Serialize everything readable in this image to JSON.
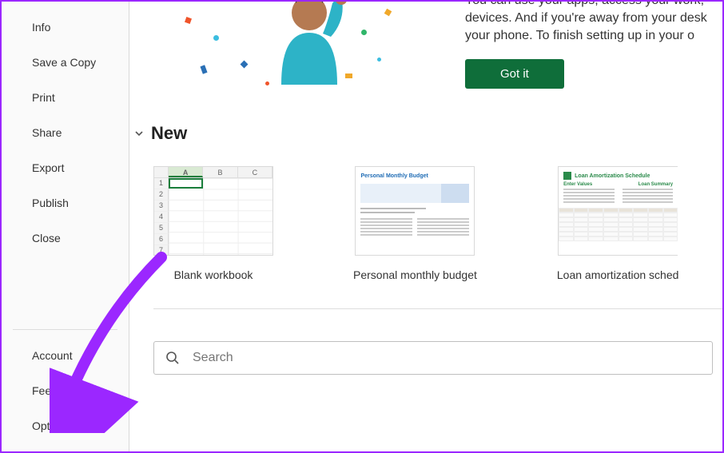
{
  "sidebar": {
    "top_items": [
      {
        "label": "Info"
      },
      {
        "label": "Save a Copy"
      },
      {
        "label": "Print"
      },
      {
        "label": "Share"
      },
      {
        "label": "Export"
      },
      {
        "label": "Publish"
      },
      {
        "label": "Close"
      }
    ],
    "bottom_items": [
      {
        "label": "Account"
      },
      {
        "label": "Feedback"
      },
      {
        "label": "Options"
      }
    ]
  },
  "banner": {
    "text": "You can use your apps, access your work, devices. And if you're away from your desk your phone. To finish setting up in your o",
    "button_label": "Got it"
  },
  "new_section": {
    "title": "New",
    "templates": [
      {
        "label": "Blank workbook",
        "columns": [
          "A",
          "B",
          "C"
        ],
        "rows": [
          "1",
          "2",
          "3",
          "4",
          "5",
          "6",
          "7"
        ]
      },
      {
        "label": "Personal monthly budget",
        "heading": "Personal Monthly Budget"
      },
      {
        "label": "Loan amortization sched",
        "heading": "Loan Amortization Schedule",
        "sub_left": "Enter Values",
        "sub_right": "Loan Summary"
      }
    ]
  },
  "search": {
    "placeholder": "Search"
  },
  "colors": {
    "accent": "#0f6e3a",
    "annotation": "#9b27ff"
  }
}
